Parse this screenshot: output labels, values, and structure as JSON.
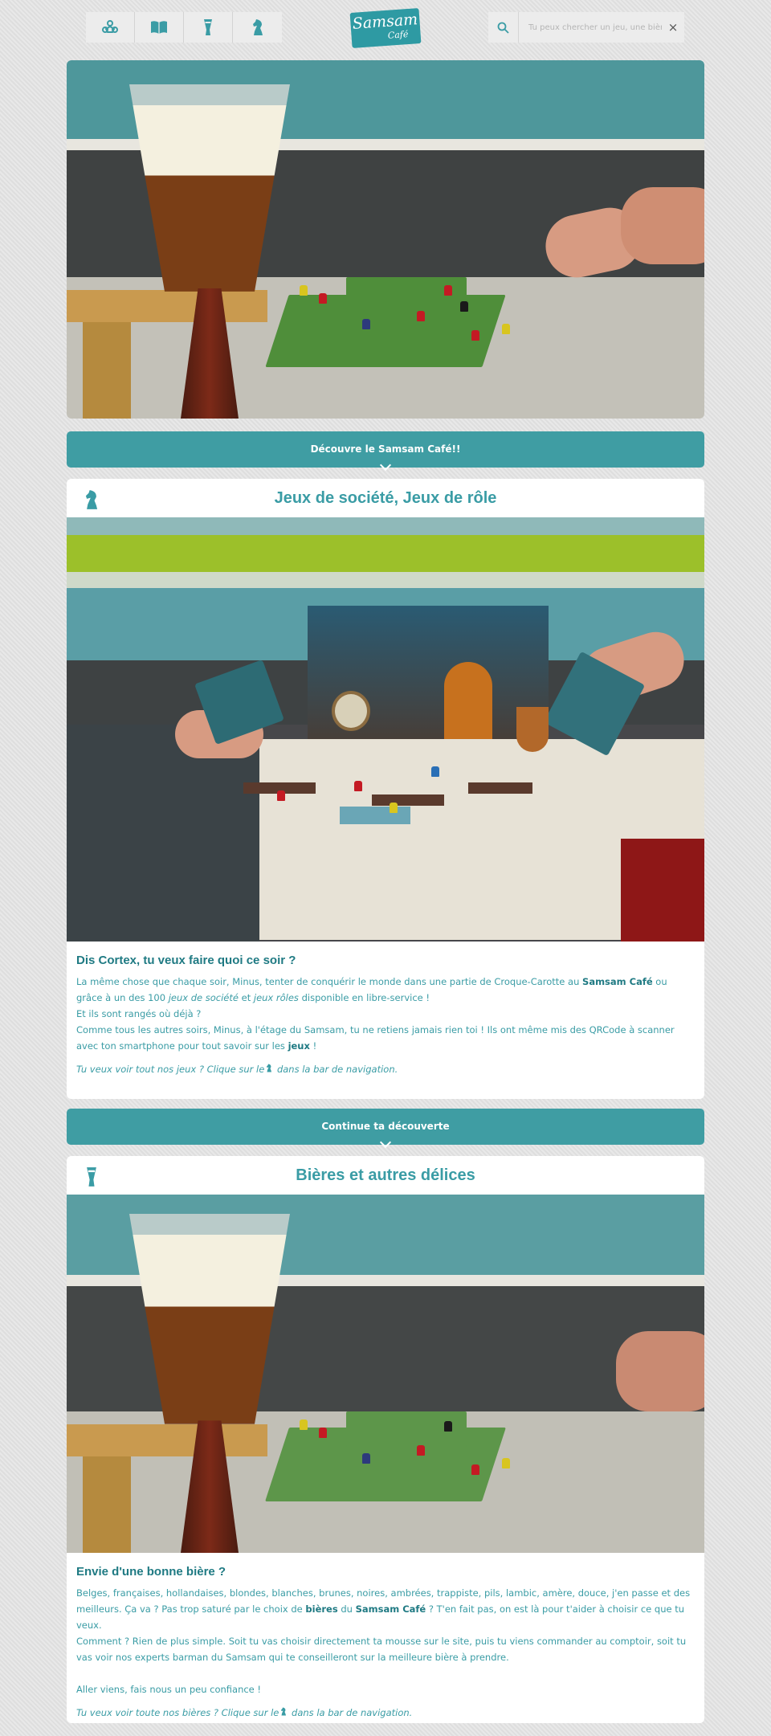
{
  "nav": {
    "items": [
      {
        "icon": "meeples-icon"
      },
      {
        "icon": "book-icon"
      },
      {
        "icon": "beer-glass-icon"
      },
      {
        "icon": "knight-icon"
      }
    ]
  },
  "logo": {
    "line1": "Samsam",
    "line2": "Café"
  },
  "search": {
    "placeholder": "Tu peux chercher un jeu, une bièr",
    "clear": "×"
  },
  "banner1": {
    "label": "Découvre le Samsam Café!!"
  },
  "card1": {
    "icon": "knight-icon",
    "title": "Jeux de société, Jeux de rôle",
    "heading": "Dis Cortex, tu veux faire quoi ce soir ?",
    "p1_a": "La même chose que chaque soir, Minus, tenter de conquérir le monde dans une partie de Croque-Carotte au ",
    "p1_b": "Samsam Café",
    "p1_c": " ou grâce à un des 100 ",
    "p1_d": "jeux de société",
    "p1_e": " et ",
    "p1_f": "jeux rôles",
    "p1_g": " disponible en libre-service !",
    "p2": "Et ils sont rangés où déjà ?",
    "p3_a": "Comme tous les autres soirs, Minus, à l'étage du Samsam, tu ne retiens jamais rien toi ! Ils ont même mis des QRCode à scanner avec ton smartphone pour tout savoir sur les ",
    "p3_b": "jeux",
    "p3_c": " !",
    "hint_a": "Tu veux voir tout nos jeux ? Clique sur le",
    "hint_b": " dans la bar de navigation."
  },
  "banner2": {
    "label": "Continue ta découverte"
  },
  "card2": {
    "icon": "beer-glass-icon",
    "title": "Bières et autres délices",
    "heading": "Envie d'une bonne bière ?",
    "p1_a": "Belges, françaises, hollandaises, blondes, blanches, brunes, noires, ambrées, trappiste, pils, lambic, amère, douce, j'en passe et des meilleurs. Ça va ? Pas trop saturé par le choix de ",
    "p1_b": "bières",
    "p1_c": " du ",
    "p1_d": "Samsam Café",
    "p1_e": " ? T'en fait pas, on est là pour t'aider à choisir ce que tu veux.",
    "p2": "Comment ? Rien de plus simple. Soit tu vas choisir directement ta mousse sur le site, puis tu viens commander au comptoir, soit tu vas voir nos experts barman du Samsam qui te conseilleront sur la meilleure bière à prendre.",
    "p3": "Aller viens, fais nous un peu confiance !",
    "hint_a": "Tu veux voir toute nos bières ? Clique sur le",
    "hint_b": " dans la bar de navigation."
  },
  "colors": {
    "accent": "#3f9da3",
    "text": "#3a9ca5",
    "heading": "#1f7a83",
    "background": "#e3e3e3"
  }
}
